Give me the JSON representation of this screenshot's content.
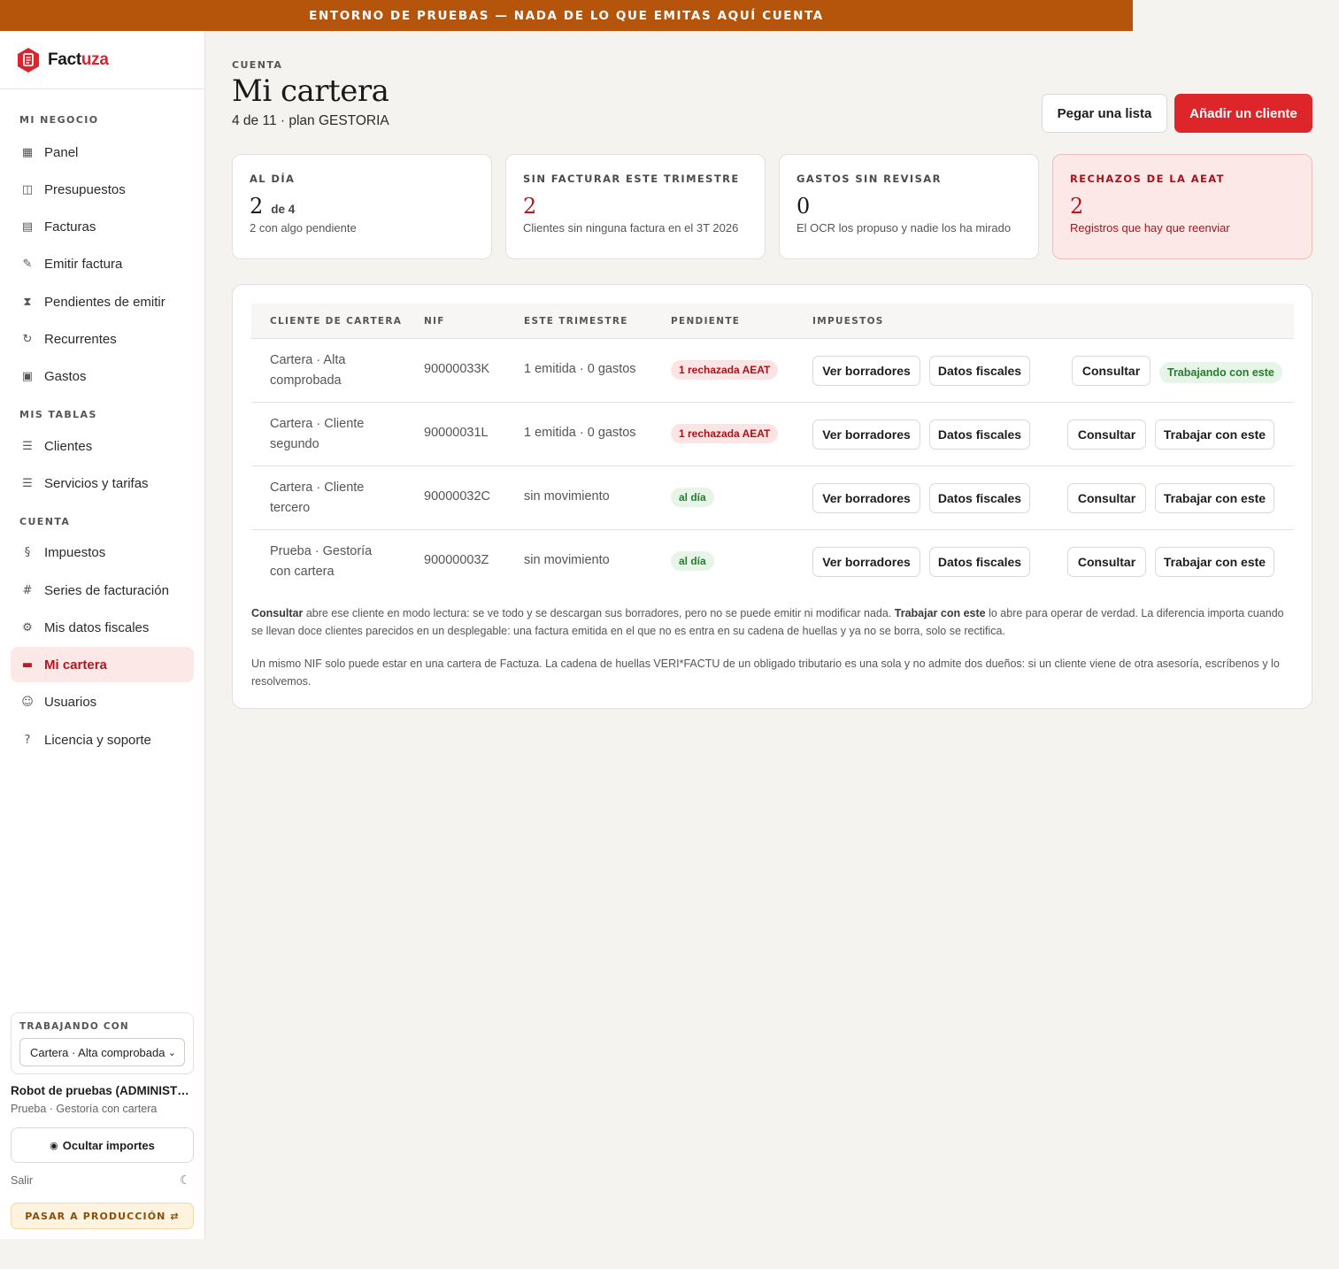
{
  "banner": "ENTORNO DE PRUEBAS — NADA DE LO QUE EMITAS AQUÍ CUENTA",
  "brand": {
    "name_a": "Fact",
    "name_b": "uza",
    "accent": "#d9252e"
  },
  "sidebar": {
    "groups": [
      "MI NEGOCIO",
      "MIS TABLAS",
      "CUENTA"
    ],
    "items": [
      {
        "label": "Panel",
        "icon": "grid-icon"
      },
      {
        "label": "Presupuestos",
        "icon": "book-icon"
      },
      {
        "label": "Facturas",
        "icon": "list-icon"
      },
      {
        "label": "Emitir factura",
        "icon": "pen-icon"
      },
      {
        "label": "Pendientes de emitir",
        "icon": "hourglass-icon"
      },
      {
        "label": "Recurrentes",
        "icon": "repeat-icon"
      },
      {
        "label": "Gastos",
        "icon": "camera-icon"
      },
      {
        "label": "Clientes",
        "icon": "menu-icon"
      },
      {
        "label": "Servicios y tarifas",
        "icon": "menu-icon"
      },
      {
        "label": "Impuestos",
        "icon": "section-icon"
      },
      {
        "label": "Series de facturación",
        "icon": "hash-icon"
      },
      {
        "label": "Mis datos fiscales",
        "icon": "gear-icon"
      },
      {
        "label": "Mi cartera",
        "icon": "briefcase-icon"
      },
      {
        "label": "Usuarios",
        "icon": "user-icon"
      },
      {
        "label": "Licencia y soporte",
        "icon": "help-icon"
      }
    ],
    "working_label": "TRABAJANDO CON",
    "working_value": "Cartera · Alta comprobada",
    "user_name": "Robot de pruebas (ADMINISTRADOR)",
    "user_org": "Prueba · Gestoría con cartera",
    "hide_amounts": "Ocultar importes",
    "logout": "Salir",
    "go_production": "PASAR A PRODUCCIÓN ⇄"
  },
  "header": {
    "eyebrow": "CUENTA",
    "title": "Mi cartera",
    "subtitle": "4 de 11 · plan GESTORIA",
    "btn_paste": "Pegar una lista",
    "btn_add": "Añadir un cliente"
  },
  "stats": [
    {
      "title": "AL DÍA",
      "value": "2",
      "suffix": "de 4",
      "desc": "2 con algo pendiente"
    },
    {
      "title": "SIN FACTURAR ESTE TRIMESTRE",
      "value": "2",
      "desc": "Clientes sin ninguna factura en el 3T 2026"
    },
    {
      "title": "GASTOS SIN REVISAR",
      "value": "0",
      "desc": "El OCR los propuso y nadie los ha mirado"
    },
    {
      "title": "RECHAZOS DE LA AEAT",
      "value": "2",
      "desc": "Registros que hay que reenviar"
    }
  ],
  "table": {
    "headers": [
      "CLIENTE DE CARTERA",
      "NIF",
      "ESTE TRIMESTRE",
      "PENDIENTE",
      "IMPUESTOS"
    ],
    "btn_drafts": "Ver borradores",
    "btn_fiscal": "Datos fiscales",
    "btn_consult": "Consultar",
    "btn_work": "Trabajar con este",
    "working_pill": "Trabajando con este",
    "rows": [
      {
        "name": "Cartera · Alta comprobada",
        "nif": "90000033K",
        "quarter": "1 emitida · 0 gastos",
        "pending": "1 rechazada AEAT"
      },
      {
        "name": "Cartera · Cliente segundo",
        "nif": "90000031L",
        "quarter": "1 emitida · 0 gastos",
        "pending": "1 rechazada AEAT"
      },
      {
        "name": "Cartera · Cliente tercero",
        "nif": "90000032C",
        "quarter": "sin movimiento",
        "pending": "al día"
      },
      {
        "name": "Prueba · Gestoría con cartera",
        "nif": "90000003Z",
        "quarter": "sin movimiento",
        "pending": "al día"
      }
    ]
  },
  "notes": {
    "n1_a": "Consultar",
    "n1_b": " abre ese cliente en modo lectura: se ve todo y se descargan sus borradores, pero no se puede emitir ni modificar nada. ",
    "n1_c": "Trabajar con este",
    "n1_d": " lo abre para operar de verdad. La diferencia importa cuando se llevan doce clientes parecidos en un desplegable: una factura emitida en el que no es entra en su cadena de huellas y ya no se borra, solo se rectifica.",
    "n2": "Un mismo NIF solo puede estar en una cartera de Factuza. La cadena de huellas VERI*FACTU de un obligado tributario es una sola y no admite dos dueños: si un cliente viene de otra asesoría, escríbenos y lo resolvemos."
  }
}
